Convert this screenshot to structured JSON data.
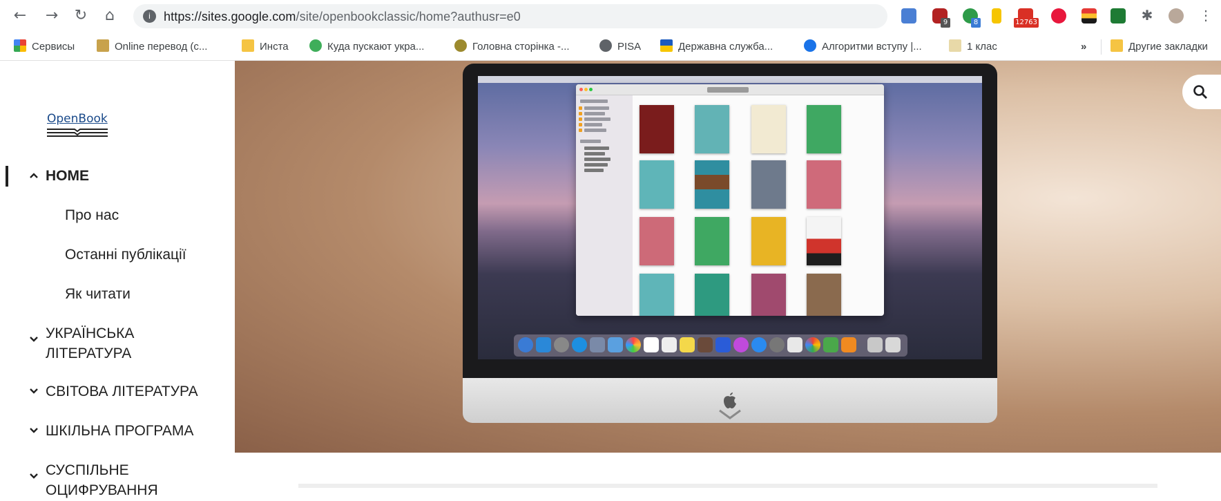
{
  "browser": {
    "url_host": "https://sites.google.com",
    "url_path": "/site/openbookclassic/home?authusr=e0",
    "ext_badges": [
      "9",
      "8",
      "12763"
    ]
  },
  "bookmarks": [
    {
      "label": "Сервисы",
      "icon": "apps-grid-icon"
    },
    {
      "label": "Online перевод (с...",
      "icon": "translate-icon"
    },
    {
      "label": "Инста",
      "icon": "folder-icon"
    },
    {
      "label": "Куда пускают укра...",
      "icon": "star-icon"
    },
    {
      "label": "Головна сторінка -...",
      "icon": "emblem-icon"
    },
    {
      "label": "PISA",
      "icon": "globe-icon"
    },
    {
      "label": "Державна служба...",
      "icon": "trident-icon"
    },
    {
      "label": "Алгоритми вступу |...",
      "icon": "dots-icon"
    },
    {
      "label": "1 клас",
      "icon": "book-icon"
    }
  ],
  "bookmarks_more": "»",
  "bookmarks_other": "Другие закладки",
  "site": {
    "logo_text": "OpenBook",
    "nav": {
      "home": "HOME",
      "sub": [
        "Про нас",
        "Останні публікації",
        "Як читати"
      ],
      "ukr_lit": [
        "УКРАЇНСЬКА",
        "ЛІТЕРАТУРА"
      ],
      "world_lit": "СВІТОВА ЛІТЕРАТУРА",
      "school": "ШКІЛЬНА ПРОГРАМА",
      "digital": [
        "СУСПІЛЬНЕ",
        "ОЦИФРУВАННЯ"
      ]
    }
  },
  "colors": {
    "accent_link": "#1a4a8a",
    "text": "#212121",
    "omnibox_bg": "#f1f3f4"
  }
}
